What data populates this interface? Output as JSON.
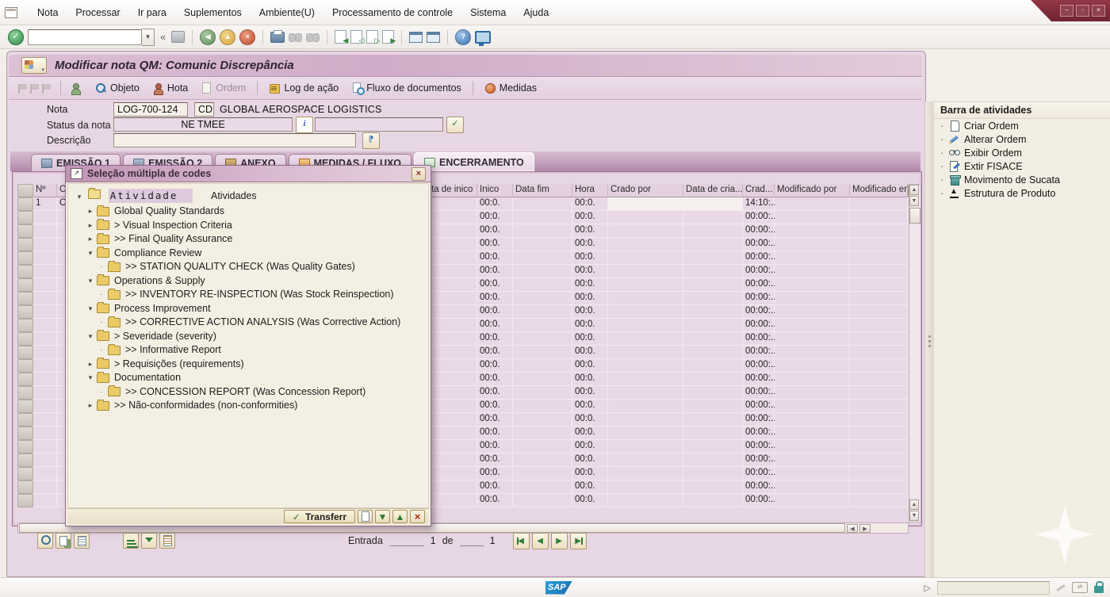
{
  "menubar": {
    "items": [
      "Nota",
      "Processar",
      "Ir para",
      "Suplementos",
      "Ambiente(U)",
      "Processamento de controle",
      "Sistema",
      "Ajuda"
    ]
  },
  "window_controls": {
    "minimize": "–",
    "maximize": "▫",
    "close": "×"
  },
  "header": {
    "title": "Modificar nota QM: Comunic Discrepância"
  },
  "app_toolbar": {
    "buttons": [
      {
        "ic": "ab-person",
        "label": "",
        "cls": "icononly"
      },
      {
        "ic": "ab-objeto",
        "label": "Objeto",
        "cls": ""
      },
      {
        "ic": "ab-nota",
        "label": "Hota",
        "cls": ""
      },
      {
        "ic": "ab-ordem",
        "label": "Ordem",
        "cls": "disabled"
      },
      {
        "ic": "",
        "label": "",
        "cls": "sep"
      },
      {
        "ic": "ab-log",
        "label": "Log de ação",
        "cls": ""
      },
      {
        "ic": "ab-fluxo",
        "label": "Fluxo de documentos",
        "cls": ""
      },
      {
        "ic": "",
        "label": "",
        "cls": "sep"
      },
      {
        "ic": "ab-medidas",
        "label": "Medidas",
        "cls": ""
      }
    ]
  },
  "form": {
    "nota_label": "Nota",
    "nota_value": "LOG-700-124",
    "nota_code": "CD",
    "nota_text": "GLOBAL AEROSPACE LOGISTICS",
    "status_label": "Status da nota",
    "status_value": "NE TMEE",
    "info_glyph": "i",
    "descricao_label": "Descrição"
  },
  "tabs": [
    {
      "ic": "ti-print",
      "label": "EMISSÃO 1",
      "cls": ""
    },
    {
      "ic": "ti-print",
      "label": "EMISSÃO 2",
      "cls": ""
    },
    {
      "ic": "ti-anexo",
      "label": "ANEXO",
      "cls": ""
    },
    {
      "ic": "ti-med",
      "label": "MEDIDAS / FLUXO",
      "cls": ""
    },
    {
      "ic": "ti-enc",
      "label": "ENCERRAMENTO",
      "cls": "active"
    }
  ],
  "table": {
    "headers": [
      "Nº",
      "C",
      "ta de inico",
      "Inico",
      "Data fim",
      "Hora",
      "Crado por",
      "Data de cria...",
      "Crad...",
      "Modificado por",
      "Modificado er"
    ],
    "rows": [
      {
        "cls": "r1",
        "no": "1",
        "c": "C",
        "ini": "00:0.",
        "hora": "00:0.",
        "crad": "14:10:.."
      },
      {
        "cls": "",
        "no": "",
        "c": "",
        "ini": "00:0.",
        "hora": "00:0.",
        "crad": "00:00:..."
      },
      {
        "cls": "",
        "no": "",
        "c": "",
        "ini": "00:0.",
        "hora": "00:0.",
        "crad": "00:00:..."
      },
      {
        "cls": "",
        "no": "",
        "c": "",
        "ini": "00:0.",
        "hora": "00:0.",
        "crad": "00:00:..."
      },
      {
        "cls": "",
        "no": "",
        "c": "",
        "ini": "00:0.",
        "hora": "00:0.",
        "crad": "00:00:..."
      },
      {
        "cls": "",
        "no": "",
        "c": "",
        "ini": "00:0.",
        "hora": "00:0.",
        "crad": "00:00:..."
      },
      {
        "cls": "",
        "no": "",
        "c": "",
        "ini": "00:0.",
        "hora": "00:0.",
        "crad": "00:00:..."
      },
      {
        "cls": "",
        "no": "",
        "c": "",
        "ini": "00:0.",
        "hora": "00:0.",
        "crad": "00:00:..."
      },
      {
        "cls": "",
        "no": "",
        "c": "",
        "ini": "00:0.",
        "hora": "00:0.",
        "crad": "00:00:..."
      },
      {
        "cls": "",
        "no": "",
        "c": "",
        "ini": "00:0.",
        "hora": "00:0.",
        "crad": "00:00:..."
      },
      {
        "cls": "",
        "no": "",
        "c": "",
        "ini": "00:0.",
        "hora": "00:0.",
        "crad": "00:00:..."
      },
      {
        "cls": "",
        "no": "",
        "c": "",
        "ini": "00:0.",
        "hora": "00:0.",
        "crad": "00:00:..."
      },
      {
        "cls": "",
        "no": "",
        "c": "",
        "ini": "00:0.",
        "hora": "00:0.",
        "crad": "00:00:..."
      },
      {
        "cls": "",
        "no": "",
        "c": "",
        "ini": "00:0.",
        "hora": "00:0.",
        "crad": "00:00:..."
      },
      {
        "cls": "",
        "no": "",
        "c": "",
        "ini": "00:0.",
        "hora": "00:0.",
        "crad": "00:00:..."
      },
      {
        "cls": "",
        "no": "",
        "c": "",
        "ini": "00:0.",
        "hora": "00:0.",
        "crad": "00:00:..."
      },
      {
        "cls": "",
        "no": "",
        "c": "",
        "ini": "00:0.",
        "hora": "00:0.",
        "crad": "00:00:..."
      },
      {
        "cls": "",
        "no": "",
        "c": "",
        "ini": "00:0.",
        "hora": "00:0.",
        "crad": "00:00:..."
      },
      {
        "cls": "",
        "no": "",
        "c": "",
        "ini": "00:0.",
        "hora": "00:0.",
        "crad": "00:00:..."
      },
      {
        "cls": "",
        "no": "",
        "c": "",
        "ini": "00:0.",
        "hora": "00:0.",
        "crad": "00:00:..."
      },
      {
        "cls": "",
        "no": "",
        "c": "",
        "ini": "00:0.",
        "hora": "00:0.",
        "crad": "00:00:..."
      },
      {
        "cls": "",
        "no": "",
        "c": "",
        "ini": "00:0.",
        "hora": "00:0.",
        "crad": "00:00:..."
      },
      {
        "cls": "",
        "no": "",
        "c": "",
        "ini": "00:0.",
        "hora": "00:0.",
        "crad": "00:00:..."
      }
    ]
  },
  "dialog": {
    "title": "Seleção múltipla de codes",
    "root": {
      "expander": "▾",
      "code": "Atividade",
      "label": "Atividades"
    },
    "items": [
      {
        "expander": "▸",
        "cls": "lvl1",
        "label": "Global Quality Standards"
      },
      {
        "expander": "▸",
        "cls": "lvl1",
        "label": "> Visual Inspection Criteria"
      },
      {
        "expander": "▸",
        "cls": "lvl1",
        "label": ">> Final Quality Assurance"
      },
      {
        "expander": "▾",
        "cls": "lvl1",
        "label": "Compliance Review"
      },
      {
        "expander": "·",
        "cls": "lvl2",
        "label": ">> STATION QUALITY CHECK (Was Quality Gates)"
      },
      {
        "expander": "▾",
        "cls": "lvl1",
        "label": "Operations & Supply"
      },
      {
        "expander": "·",
        "cls": "lvl2",
        "label": ">> INVENTORY RE-INSPECTION (Was Stock Reinspection)"
      },
      {
        "expander": "▾",
        "cls": "lvl1",
        "label": "Process Improvement"
      },
      {
        "expander": "·",
        "cls": "lvl2",
        "label": ">> CORRECTIVE ACTION ANALYSIS (Was Corrective Action)"
      },
      {
        "expander": "▾",
        "cls": "lvl1",
        "label": "> Severidade (severity)"
      },
      {
        "expander": "·",
        "cls": "lvl2",
        "label": ">> Informative Report"
      },
      {
        "expander": "▸",
        "cls": "lvl1",
        "label": "> Requisições (requirements)"
      },
      {
        "expander": "▾",
        "cls": "lvl1",
        "label": "Documentation"
      },
      {
        "expander": "·",
        "cls": "lvl2",
        "label": ">> CONCESSION REPORT (Was Concession Report)"
      },
      {
        "expander": "▸",
        "cls": "lvl1",
        "label": ">> Não-conformidades (non-conformities)"
      }
    ],
    "transfer_label": "Transferr",
    "transfer_check": "✓",
    "expand_glyph": "▼",
    "collapse_glyph": "▲",
    "close_glyph": "×"
  },
  "activity_bar": {
    "title": "Barra de atividades",
    "items": [
      {
        "ic": "sb-page",
        "label": "Criar Ordem"
      },
      {
        "ic": "sb-pencil",
        "label": "Alterar Ordem"
      },
      {
        "ic": "sb-glasses",
        "label": "Exibir Ordem"
      },
      {
        "ic": "sb-pageedit",
        "label": "Extir FISACE"
      },
      {
        "ic": "sb-trash",
        "label": "Movimento de Sucata"
      },
      {
        "ic": "sb-tree",
        "label": "Estrutura de Produto"
      }
    ]
  },
  "pager": {
    "entrada_label": "Entrada",
    "current": "1",
    "de_label": "de",
    "total": "1"
  },
  "status_bar": {
    "logo": "SAP"
  },
  "icons": {
    "quickbar": [
      "enter-check-icon",
      "command-field",
      "collapse-chevrons-icon",
      "save-icon",
      "back-icon",
      "exit-icon",
      "cancel-icon",
      "print-icon",
      "find-icon",
      "find-next-icon",
      "first-page-icon",
      "previous-page-icon",
      "next-page-icon",
      "last-page-icon",
      "new-session-icon",
      "shortcut-icon",
      "help-icon",
      "customize-icon"
    ],
    "colors": {
      "banner_maroon": "#7b2733",
      "panel_pink": "#e7d6e3",
      "dialog_beige": "#f4efe3",
      "button_beige": "#f3ecd6",
      "sap_blue": "#1c7ac0",
      "folder_yellow": "#eccb66",
      "green_check": "#2e7d36",
      "red_x": "#b02a1c"
    }
  }
}
